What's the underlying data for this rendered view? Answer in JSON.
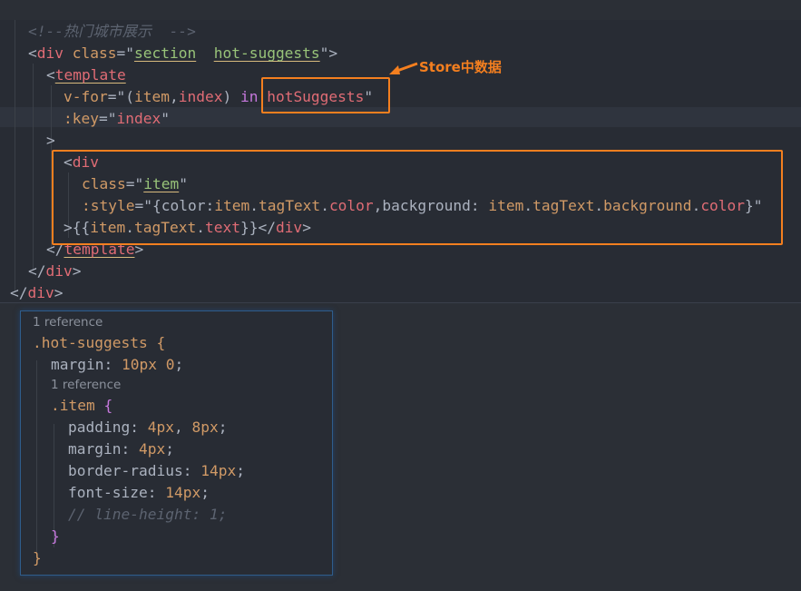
{
  "editor": {
    "lines": [
      {
        "parts": [
          {
            "t": "<!--热门城市展示  -->",
            "c": "c-com"
          }
        ]
      },
      {
        "parts": [
          {
            "t": "<",
            "c": "c-punc"
          },
          {
            "t": "div",
            "c": "c-tag"
          },
          {
            "t": " class",
            "c": "c-attr"
          },
          {
            "t": "=\"",
            "c": "c-punc"
          },
          {
            "t": "section",
            "c": "c-str u"
          },
          {
            "t": "  ",
            "c": "c-str"
          },
          {
            "t": "hot-suggests",
            "c": "c-str u"
          },
          {
            "t": "\">",
            "c": "c-punc"
          }
        ]
      },
      {
        "parts": [
          {
            "t": "<",
            "c": "c-punc"
          },
          {
            "t": "template",
            "c": "c-tag u"
          }
        ]
      },
      {
        "parts": [
          {
            "t": "v-for",
            "c": "c-attr"
          },
          {
            "t": "=\"(",
            "c": "c-punc"
          },
          {
            "t": "item",
            "c": "c-attr"
          },
          {
            "t": ",",
            "c": "c-punc"
          },
          {
            "t": "index",
            "c": "c-tag"
          },
          {
            "t": ") ",
            "c": "c-punc"
          },
          {
            "t": "in",
            "c": "c-kw"
          },
          {
            "t": " ",
            "c": "c-punc"
          },
          {
            "t": "hotSuggests",
            "c": "c-tag"
          },
          {
            "t": "\"",
            "c": "c-punc"
          }
        ]
      },
      {
        "parts": [
          {
            "t": ":key",
            "c": "c-attr"
          },
          {
            "t": "=\"",
            "c": "c-punc"
          },
          {
            "t": "index",
            "c": "c-tag"
          },
          {
            "t": "\"",
            "c": "c-punc"
          }
        ]
      },
      {
        "parts": [
          {
            "t": ">",
            "c": "c-punc"
          }
        ]
      },
      {
        "parts": [
          {
            "t": "<",
            "c": "c-punc"
          },
          {
            "t": "div",
            "c": "c-tag"
          }
        ]
      },
      {
        "parts": [
          {
            "t": "class",
            "c": "c-attr"
          },
          {
            "t": "=\"",
            "c": "c-punc"
          },
          {
            "t": "item",
            "c": "c-str u"
          },
          {
            "t": "\"",
            "c": "c-punc"
          }
        ]
      },
      {
        "parts": [
          {
            "t": ":style",
            "c": "c-attr"
          },
          {
            "t": "=\"{",
            "c": "c-punc"
          },
          {
            "t": "color",
            "c": "c-punc"
          },
          {
            "t": ":",
            "c": "c-punc"
          },
          {
            "t": "item",
            "c": "c-attr"
          },
          {
            "t": ".",
            "c": "c-punc"
          },
          {
            "t": "tagText",
            "c": "c-attr"
          },
          {
            "t": ".",
            "c": "c-punc"
          },
          {
            "t": "color",
            "c": "c-tag"
          },
          {
            "t": ",background: ",
            "c": "c-punc"
          },
          {
            "t": "item",
            "c": "c-attr"
          },
          {
            "t": ".",
            "c": "c-punc"
          },
          {
            "t": "tagText",
            "c": "c-attr"
          },
          {
            "t": ".",
            "c": "c-punc"
          },
          {
            "t": "background",
            "c": "c-attr"
          },
          {
            "t": ".",
            "c": "c-punc"
          },
          {
            "t": "color",
            "c": "c-tag"
          },
          {
            "t": "}\"",
            "c": "c-punc"
          }
        ]
      },
      {
        "parts": [
          {
            "t": ">{{",
            "c": "c-punc"
          },
          {
            "t": "item",
            "c": "c-attr"
          },
          {
            "t": ".",
            "c": "c-punc"
          },
          {
            "t": "tagText",
            "c": "c-attr"
          },
          {
            "t": ".",
            "c": "c-punc"
          },
          {
            "t": "text",
            "c": "c-tag"
          },
          {
            "t": "}}</",
            "c": "c-punc"
          },
          {
            "t": "div",
            "c": "c-tag"
          },
          {
            "t": ">",
            "c": "c-punc"
          }
        ]
      },
      {
        "parts": [
          {
            "t": "</",
            "c": "c-punc"
          },
          {
            "t": "template",
            "c": "c-tag u"
          },
          {
            "t": ">",
            "c": "c-punc"
          }
        ]
      },
      {
        "parts": [
          {
            "t": "</",
            "c": "c-punc"
          },
          {
            "t": "div",
            "c": "c-tag"
          },
          {
            "t": ">",
            "c": "c-punc"
          }
        ]
      },
      {
        "parts": [
          {
            "t": "</",
            "c": "c-punc"
          },
          {
            "t": "div",
            "c": "c-tag"
          },
          {
            "t": ">",
            "c": "c-punc"
          }
        ]
      }
    ]
  },
  "annotation": {
    "label": "Store中数据"
  },
  "css_panel": {
    "ref1": "1 reference",
    "ref2": "1 reference",
    "lines": [
      {
        "parts": [
          {
            "t": ".hot-suggests ",
            "c": "sel"
          },
          {
            "t": "{",
            "c": "brace-y"
          }
        ]
      },
      {
        "parts": [
          {
            "t": "margin",
            "c": "prop"
          },
          {
            "t": ": ",
            "c": "prop"
          },
          {
            "t": "10px 0",
            "c": "num"
          },
          {
            "t": ";",
            "c": "prop"
          }
        ]
      },
      {
        "parts": [
          {
            "t": ".item ",
            "c": "sel"
          },
          {
            "t": "{",
            "c": "brace-p"
          }
        ]
      },
      {
        "parts": [
          {
            "t": "padding",
            "c": "prop"
          },
          {
            "t": ": ",
            "c": "prop"
          },
          {
            "t": "4px",
            "c": "num"
          },
          {
            "t": ", ",
            "c": "prop"
          },
          {
            "t": "8px",
            "c": "num"
          },
          {
            "t": ";",
            "c": "prop"
          }
        ]
      },
      {
        "parts": [
          {
            "t": "margin",
            "c": "prop"
          },
          {
            "t": ": ",
            "c": "prop"
          },
          {
            "t": "4px",
            "c": "num"
          },
          {
            "t": ";",
            "c": "prop"
          }
        ]
      },
      {
        "parts": [
          {
            "t": "border-radius",
            "c": "prop"
          },
          {
            "t": ": ",
            "c": "prop"
          },
          {
            "t": "14px",
            "c": "num"
          },
          {
            "t": ";",
            "c": "prop"
          }
        ]
      },
      {
        "parts": [
          {
            "t": "font-size",
            "c": "prop"
          },
          {
            "t": ": ",
            "c": "prop"
          },
          {
            "t": "14px",
            "c": "num"
          },
          {
            "t": ";",
            "c": "prop"
          }
        ]
      },
      {
        "parts": [
          {
            "t": "// line-height: 1;",
            "c": "c-com"
          }
        ]
      },
      {
        "parts": [
          {
            "t": "}",
            "c": "brace-p"
          }
        ]
      },
      {
        "parts": [
          {
            "t": "}",
            "c": "brace-y"
          }
        ]
      }
    ]
  }
}
